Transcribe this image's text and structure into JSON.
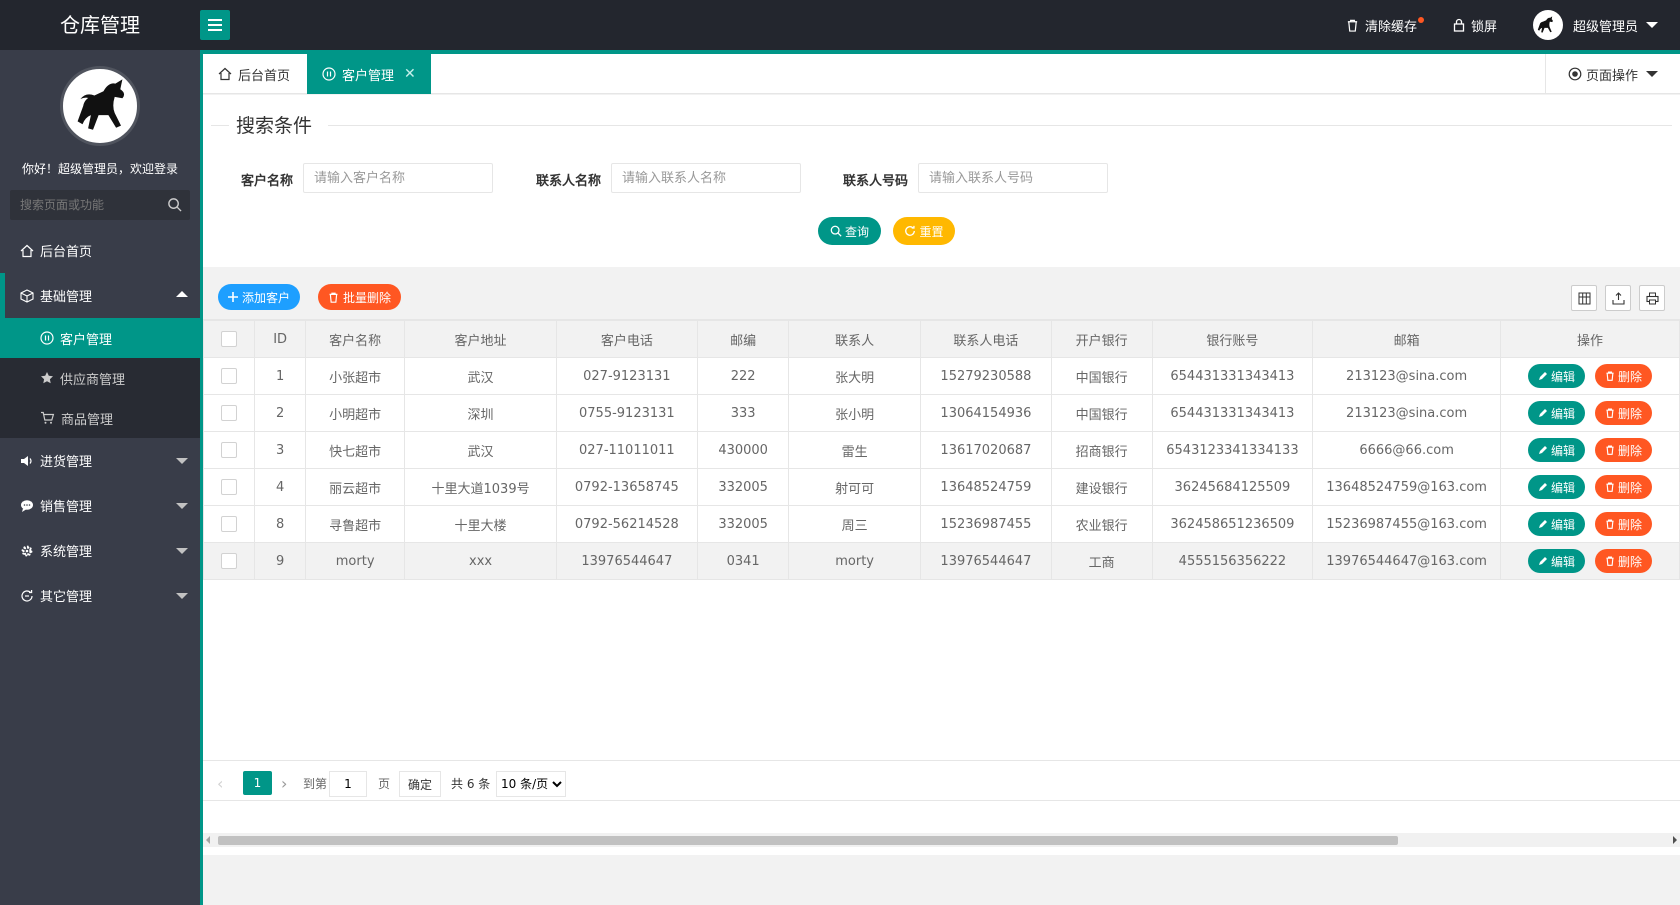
{
  "app": {
    "title": "仓库管理"
  },
  "header": {
    "clear_cache": "清除缓存",
    "lock_screen": "锁屏",
    "user_name": "超级管理员"
  },
  "sidebar": {
    "welcome": "你好！超级管理员，欢迎登录",
    "search_placeholder": "搜索页面或功能",
    "items": [
      {
        "label": "后台首页",
        "icon": "home-icon"
      },
      {
        "label": "基础管理",
        "icon": "cube-icon",
        "expanded": true,
        "children": [
          {
            "label": "客户管理",
            "icon": "pause-circle-icon",
            "active": true
          },
          {
            "label": "供应商管理",
            "icon": "star-icon"
          },
          {
            "label": "商品管理",
            "icon": "cart-icon"
          }
        ]
      },
      {
        "label": "进货管理",
        "icon": "speaker-icon"
      },
      {
        "label": "销售管理",
        "icon": "chat-icon"
      },
      {
        "label": "系统管理",
        "icon": "gear-icon"
      },
      {
        "label": "其它管理",
        "icon": "refresh-circle-icon"
      }
    ]
  },
  "tabs": [
    {
      "label": "后台首页",
      "icon": "home-icon"
    },
    {
      "label": "客户管理",
      "icon": "pause-circle-icon",
      "active": true,
      "close": "✕"
    }
  ],
  "page_ops": "页面操作",
  "search": {
    "title": "搜索条件",
    "fields": [
      {
        "label": "客户名称",
        "placeholder": "请输入客户名称"
      },
      {
        "label": "联系人名称",
        "placeholder": "请输入联系人名称"
      },
      {
        "label": "联系人号码",
        "placeholder": "请输入联系人号码"
      }
    ],
    "query_label": "查询",
    "reset_label": "重置"
  },
  "toolbar": {
    "add_label": "添加客户",
    "batch_delete_label": "批量删除"
  },
  "table": {
    "columns": [
      "",
      "ID",
      "客户名称",
      "客户地址",
      "客户电话",
      "邮编",
      "联系人",
      "联系人电话",
      "开户银行",
      "银行账号",
      "邮箱",
      "操作"
    ],
    "edit_label": "编辑",
    "delete_label": "删除",
    "rows": [
      [
        "1",
        "小张超市",
        "武汉",
        "027-9123131",
        "222",
        "张大明",
        "15279230588",
        "中国银行",
        "654431331343413",
        "213123@sina.com"
      ],
      [
        "2",
        "小明超市",
        "深圳",
        "0755-9123131",
        "333",
        "张小明",
        "13064154936",
        "中国银行",
        "654431331343413",
        "213123@sina.com"
      ],
      [
        "3",
        "快七超市",
        "武汉",
        "027-11011011",
        "430000",
        "雷生",
        "13617020687",
        "招商银行",
        "6543123341334133",
        "6666@66.com"
      ],
      [
        "4",
        "丽云超市",
        "十里大道1039号",
        "0792-13658745",
        "332005",
        "射可可",
        "13648524759",
        "建设银行",
        "36245684125509",
        "13648524759@163.com"
      ],
      [
        "8",
        "寻鲁超市",
        "十里大楼",
        "0792-56214528",
        "332005",
        "周三",
        "15236987455",
        "农业银行",
        "362458651236509",
        "15236987455@163.com"
      ],
      [
        "9",
        "morty",
        "xxx",
        "13976544647",
        "0341",
        "morty",
        "13976544647",
        "工商",
        "4555156356222",
        "13976544647@163.com"
      ]
    ]
  },
  "pager": {
    "current": "1",
    "goto_label": "到第",
    "goto_value": "1",
    "page_label": "页",
    "confirm_label": "确定",
    "total_label": "共 6 条",
    "page_size": "10 条/页"
  },
  "colors": {
    "primary": "#009688",
    "warning": "#ffb800",
    "danger": "#ff5722",
    "info": "#1e9fff",
    "sidebar": "#393d49",
    "header": "#23262e"
  }
}
